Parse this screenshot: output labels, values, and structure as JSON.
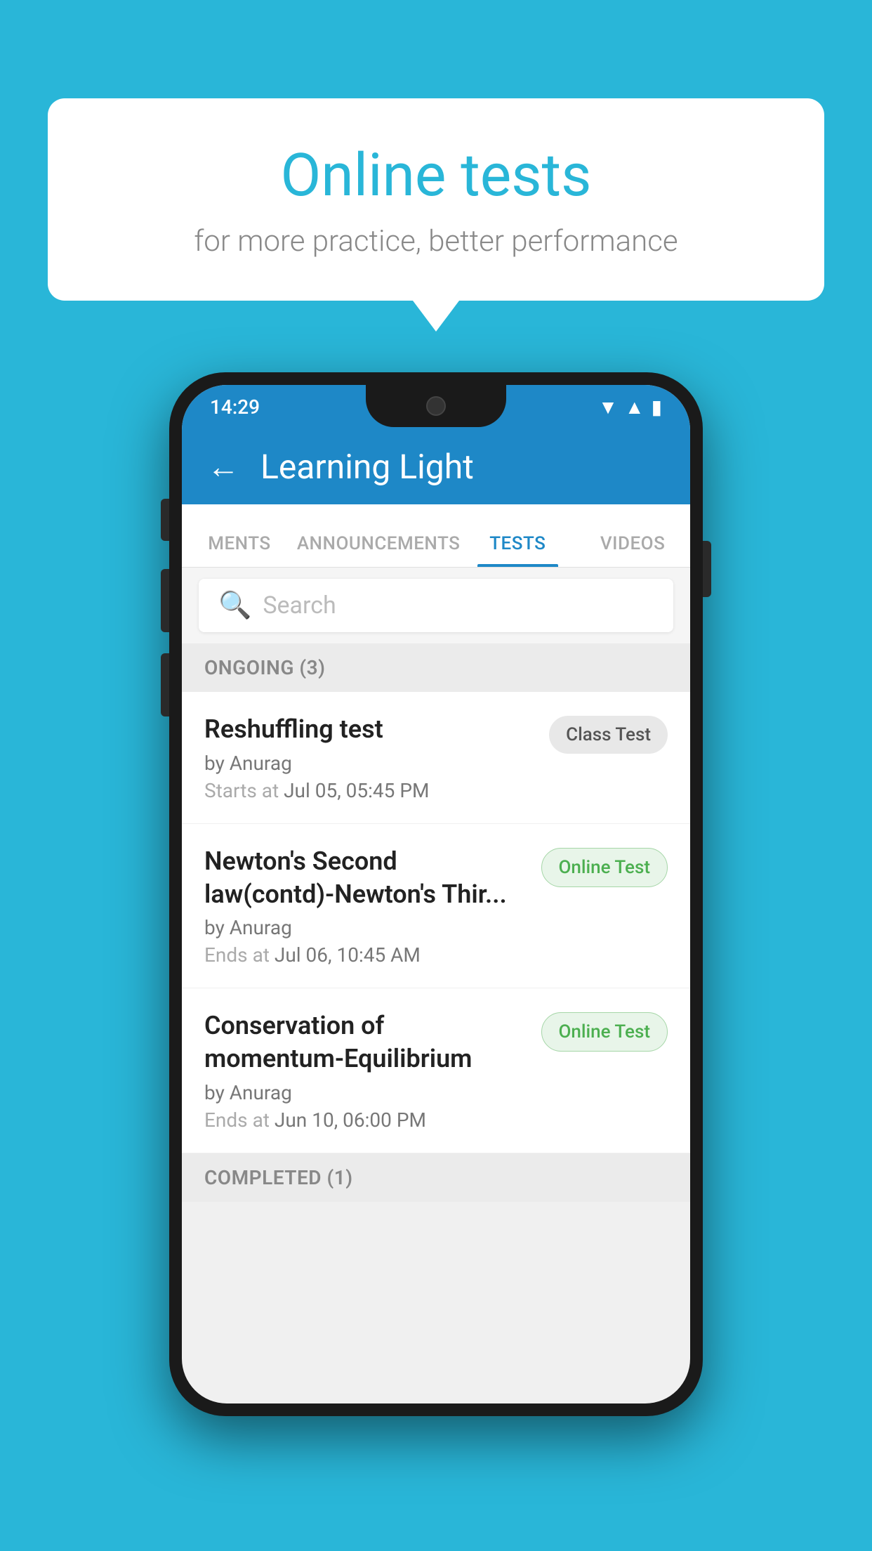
{
  "background_color": "#29b6d8",
  "speech_bubble": {
    "title": "Online tests",
    "subtitle": "for more practice, better performance"
  },
  "phone": {
    "status_bar": {
      "time": "14:29",
      "icons": [
        "wifi",
        "signal",
        "battery"
      ]
    },
    "app_header": {
      "back_label": "←",
      "title": "Learning Light"
    },
    "tabs": [
      {
        "label": "MENTS",
        "active": false
      },
      {
        "label": "ANNOUNCEMENTS",
        "active": false
      },
      {
        "label": "TESTS",
        "active": true
      },
      {
        "label": "VIDEOS",
        "active": false
      }
    ],
    "search": {
      "placeholder": "Search"
    },
    "ongoing_section": {
      "header": "ONGOING (3)",
      "items": [
        {
          "name": "Reshuffling test",
          "author": "by Anurag",
          "time_label": "Starts at",
          "time_value": "Jul 05, 05:45 PM",
          "badge": "Class Test",
          "badge_type": "class"
        },
        {
          "name": "Newton's Second law(contd)-Newton's Thir...",
          "author": "by Anurag",
          "time_label": "Ends at",
          "time_value": "Jul 06, 10:45 AM",
          "badge": "Online Test",
          "badge_type": "online"
        },
        {
          "name": "Conservation of momentum-Equilibrium",
          "author": "by Anurag",
          "time_label": "Ends at",
          "time_value": "Jun 10, 06:00 PM",
          "badge": "Online Test",
          "badge_type": "online"
        }
      ]
    },
    "completed_section": {
      "header": "COMPLETED (1)"
    }
  }
}
